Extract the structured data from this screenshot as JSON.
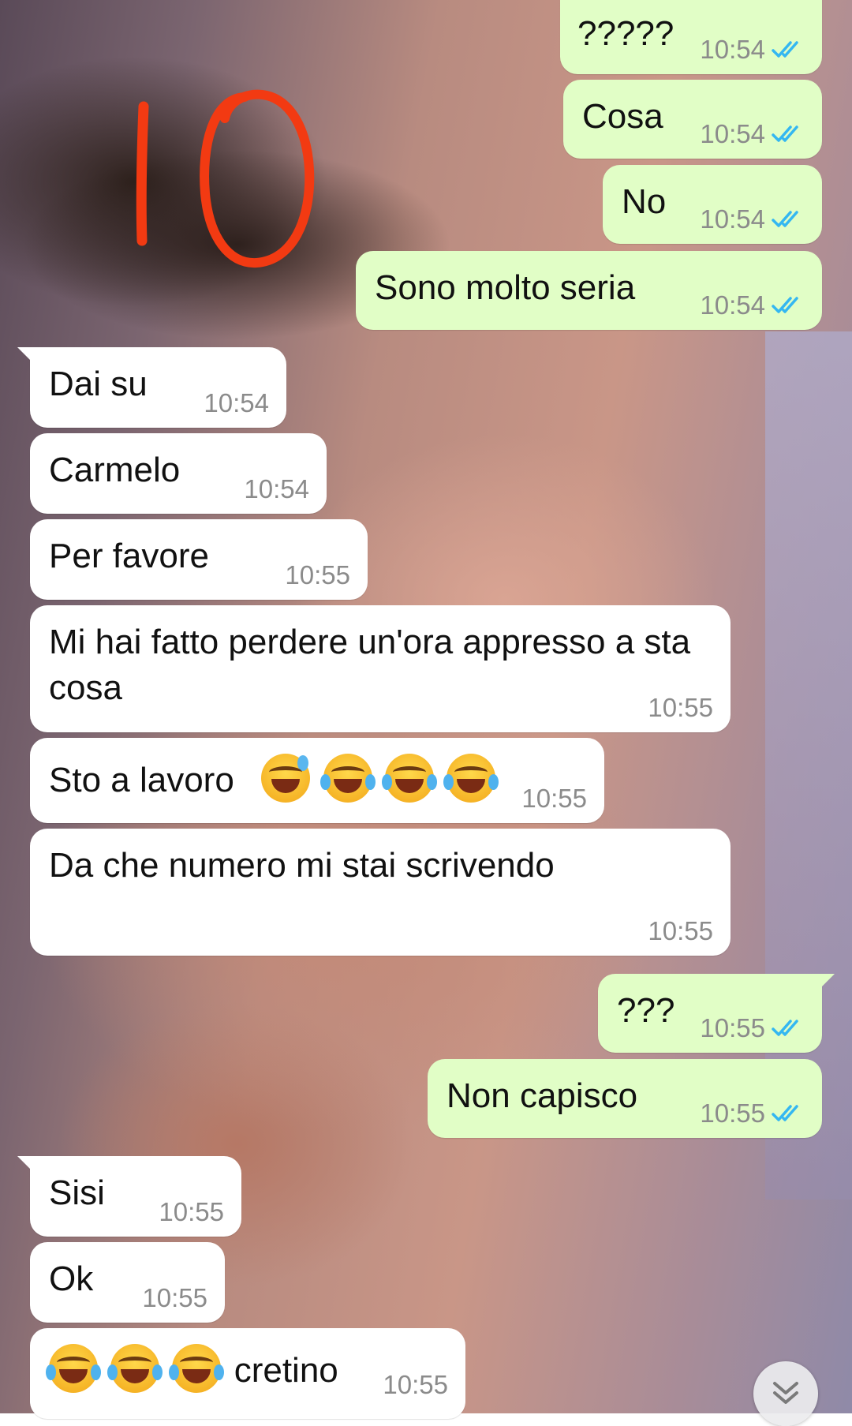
{
  "overlay": {
    "marking": "10"
  },
  "conversation": {
    "messages": [
      {
        "direction": "out",
        "text": "?????",
        "time": "10:54",
        "status": "read"
      },
      {
        "direction": "out",
        "text": "Cosa",
        "time": "10:54",
        "status": "read"
      },
      {
        "direction": "out",
        "text": "No",
        "time": "10:54",
        "status": "read"
      },
      {
        "direction": "out",
        "text": "Sono molto seria",
        "time": "10:54",
        "status": "read"
      },
      {
        "direction": "in",
        "text": "Dai su",
        "time": "10:54"
      },
      {
        "direction": "in",
        "text": "Carmelo",
        "time": "10:54"
      },
      {
        "direction": "in",
        "text": "Per favore",
        "time": "10:55"
      },
      {
        "direction": "in",
        "text": "Mi hai fatto perdere un'ora appresso a sta cosa",
        "time": "10:55"
      },
      {
        "direction": "in",
        "text": "Sto a lavoro",
        "emojis": [
          "sweat-smile",
          "tears-of-joy",
          "tears-of-joy",
          "tears-of-joy"
        ],
        "time": "10:55"
      },
      {
        "direction": "in",
        "text": "Da che numero mi stai scrivendo",
        "time": "10:55"
      },
      {
        "direction": "out",
        "text": "???",
        "time": "10:55",
        "status": "read"
      },
      {
        "direction": "out",
        "text": "Non capisco",
        "time": "10:55",
        "status": "read"
      },
      {
        "direction": "in",
        "text": "Sisi",
        "time": "10:55"
      },
      {
        "direction": "in",
        "text": "Ok",
        "time": "10:55"
      },
      {
        "direction": "in",
        "emojis": [
          "tears-of-joy",
          "tears-of-joy",
          "tears-of-joy"
        ],
        "text": "cretino",
        "time": "10:55"
      }
    ]
  },
  "scroll_to_bottom": {
    "icon": "chevron-double-down-icon"
  },
  "colors": {
    "outgoing_bubble": "#e1fec6",
    "incoming_bubble": "#ffffff",
    "read_ticks": "#34b7f1",
    "timestamp": "#8b8b8b",
    "scribble": "#f23a12"
  }
}
